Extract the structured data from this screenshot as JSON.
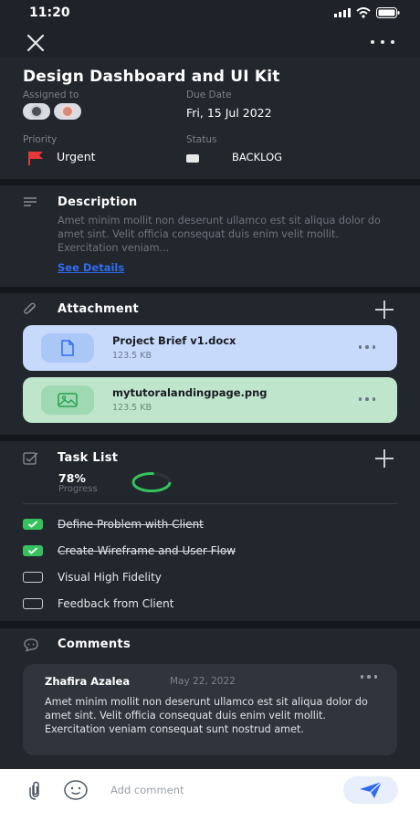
{
  "status_bar": {
    "time": "11:20"
  },
  "task": {
    "title": "Design Dashboard and UI Kit",
    "assigned_label": "Assigned to",
    "due_label": "Due Date",
    "due_value": "Fri, 15 Jul 2022",
    "priority_label": "Priority",
    "priority_value": "Urgent",
    "status_label": "Status",
    "status_value": "BACKLOG"
  },
  "description": {
    "title": "Description",
    "text": "Amet minim mollit non deserunt ullamco est sit aliqua dolor do amet sint. Velit officia consequat duis enim velit mollit. Exercitation veniam...",
    "link": "See Details"
  },
  "attachments": {
    "title": "Attachment",
    "files": [
      {
        "name": "Project Brief v1.docx",
        "size": "123.5 KB",
        "icon": "document-icon"
      },
      {
        "name": "mytutoralandingpage.png",
        "size": "123.5 KB",
        "icon": "image-icon"
      }
    ]
  },
  "task_list": {
    "title": "Task List",
    "progress_value": "78%",
    "progress_label": "Progress",
    "progress_fraction": 0.78,
    "items": [
      {
        "label": "Define Problem with Client",
        "done": true
      },
      {
        "label": "Create Wireframe and User Flow",
        "done": true
      },
      {
        "label": "Visual High Fidelity",
        "done": false
      },
      {
        "label": "Feedback from Client",
        "done": false
      }
    ]
  },
  "comments": {
    "title": "Comments",
    "items": [
      {
        "author": "Zhafira Azalea",
        "date": "May 22, 2022",
        "text": "Amet minim mollit non deserunt ullamco est sit aliqua dolor do amet sint. Velit officia consequat duis enim velit mollit. Exercitation veniam consequat sunt nostrud amet."
      }
    ]
  },
  "composer": {
    "placeholder": "Add comment"
  },
  "colors": {
    "accent_blue": "#2f6cf0",
    "progress_green": "#35c25e",
    "urgent_red": "#e5383b",
    "attachment_blue": "#c7dafc",
    "attachment_green": "#bfe5cd"
  }
}
